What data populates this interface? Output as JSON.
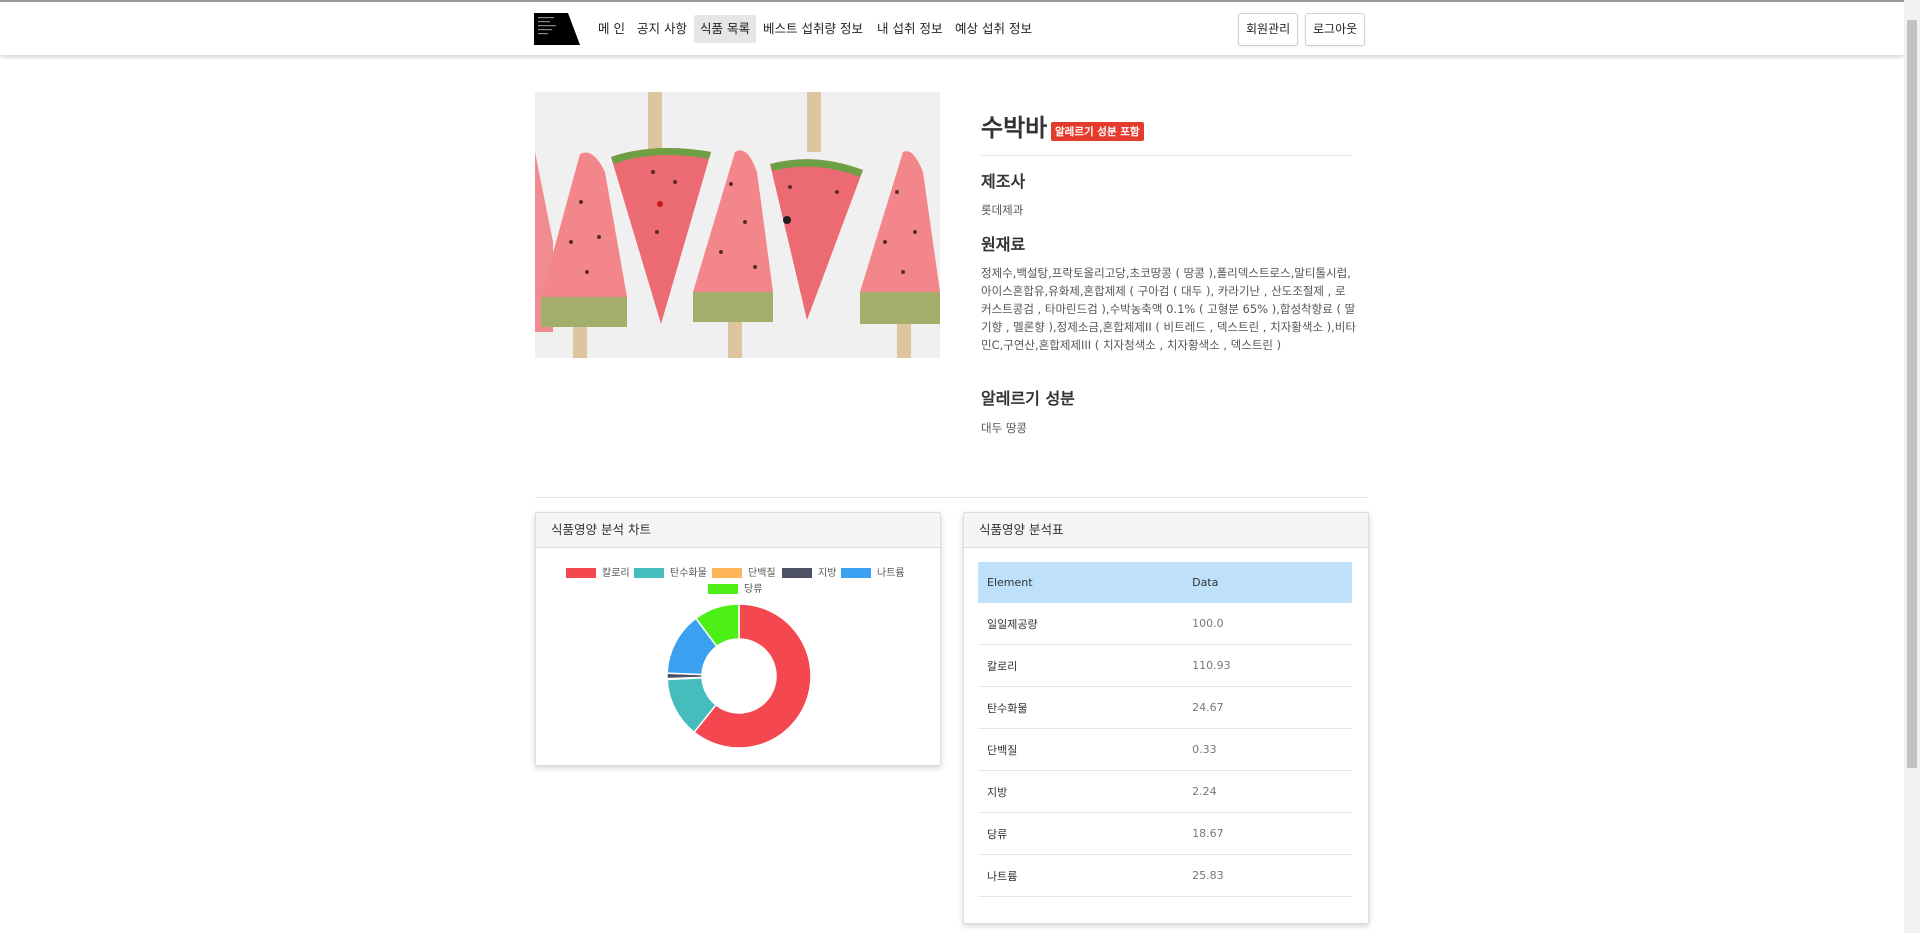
{
  "nav": {
    "items": [
      {
        "label": "메 인",
        "active": false
      },
      {
        "label": "공지 사항",
        "active": false
      },
      {
        "label": "식품 목록",
        "active": true
      },
      {
        "label": "베스트 섭취량 정보",
        "active": false
      },
      {
        "label": "내 섭취 정보",
        "active": false
      },
      {
        "label": "예상 섭취 정보",
        "active": false
      }
    ],
    "member_button": "회원관리",
    "logout_button": "로그아웃"
  },
  "product": {
    "name": "수박바",
    "allergy_badge": "알레르기 성분 포함",
    "maker_heading": "제조사",
    "maker": "롯데제과",
    "ingredients_heading": "원재료",
    "ingredients": "정제수,백설탕,프락토올리고당,초코땅콩 ( 땅콩 ),폴리덱스트로스,말티톨시럽,아이스혼합유,유화제,혼합제제 ( 구아검 ( 대두 ), 카라기난 , 산도조절제 , 로커스트콩검 , 타마린드검 ),수박농축액 0.1% ( 고형분 65% ),합성착향료 ( 딸기향 , 멜론향 ),정제소금,혼합제제II ( 비트레드 , 덱스트린 , 치자황색소 ),비타민C,구연산,혼합제제III ( 치자청색소 , 치자황색소 , 덱스트린 )",
    "allergy_heading": "알레르기 성분",
    "allergy": "대두 땅콩"
  },
  "chart_panel": {
    "title": "식품영양 분석 차트"
  },
  "table_panel": {
    "title": "식품영양 분석표",
    "columns": [
      "Element",
      "Data"
    ],
    "rows": [
      {
        "element": "일일제공량",
        "data": "100.0"
      },
      {
        "element": "칼로리",
        "data": "110.93"
      },
      {
        "element": "탄수화물",
        "data": "24.67"
      },
      {
        "element": "단백질",
        "data": "0.33"
      },
      {
        "element": "지방",
        "data": "2.24"
      },
      {
        "element": "당류",
        "data": "18.67"
      },
      {
        "element": "나트륨",
        "data": "25.83"
      }
    ]
  },
  "chart_data": {
    "type": "pie",
    "donut": true,
    "legend_position": "top",
    "categories": [
      "칼로리",
      "탄수화물",
      "단백질",
      "지방",
      "나트륨",
      "당류"
    ],
    "values": [
      110.93,
      24.67,
      0.33,
      2.24,
      25.83,
      18.67
    ],
    "colors": [
      "#f5474f",
      "#45bdbd",
      "#ffb55a",
      "#4c5263",
      "#3aa0ef",
      "#4cef16"
    ]
  }
}
